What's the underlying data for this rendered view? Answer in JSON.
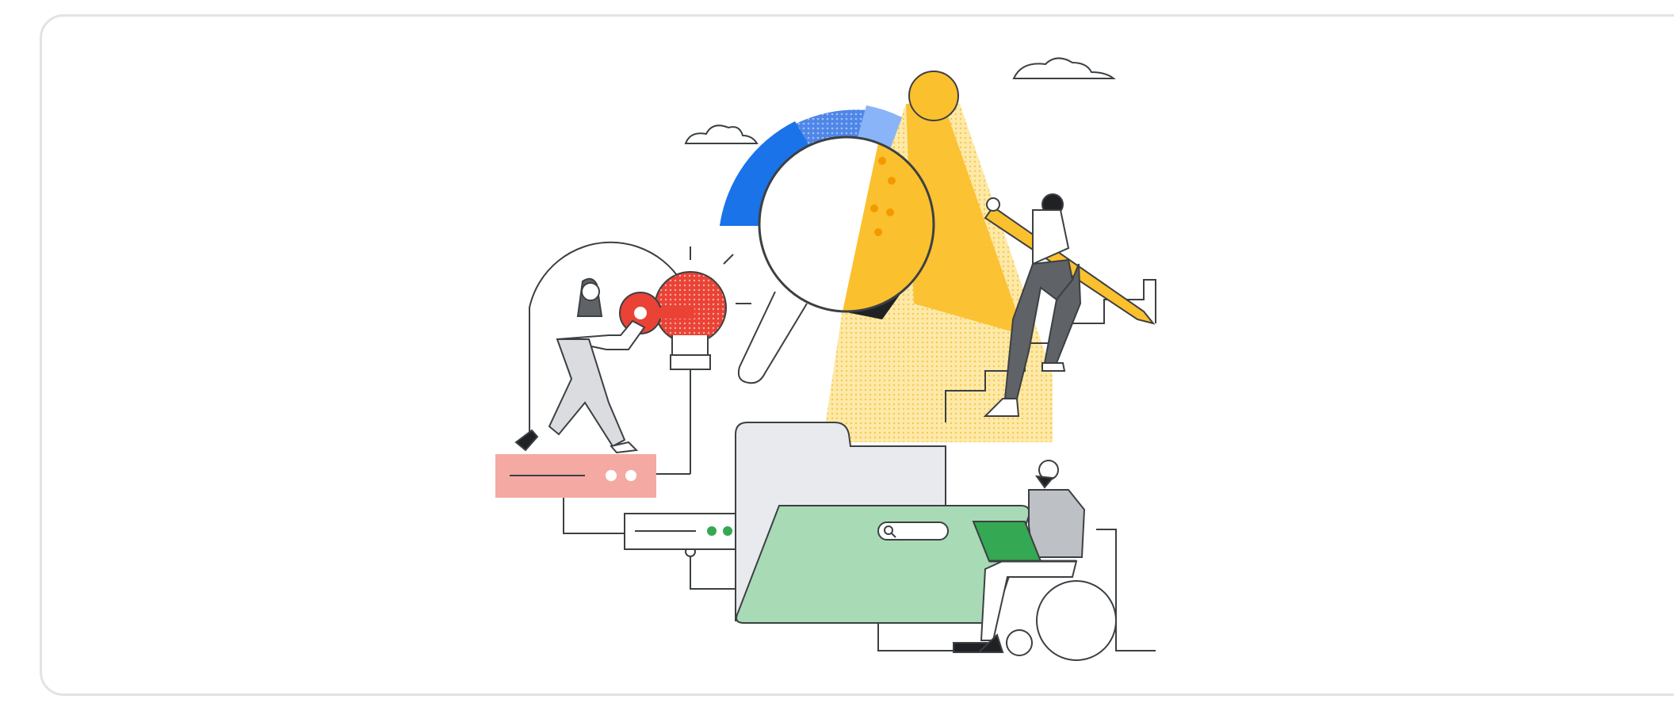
{
  "card": {
    "illustration": {
      "icons": {
        "search_bar": "search-icon",
        "lightbulb": "lightbulb-icon",
        "key": "key-icon",
        "magnifier": "magnifying-glass-icon",
        "pencil": "pencil-icon",
        "laptop": "laptop-icon",
        "wheelchair": "wheelchair-icon",
        "folder": "folder-icon",
        "clouds": "cloud-icon"
      },
      "colors": {
        "blue": "#1a73e8",
        "light_blue": "#8ab4f8",
        "yellow": "#fbc02d",
        "light_yellow": "#fde293",
        "red": "#ea4335",
        "pink": "#f4a9a3",
        "green": "#34a853",
        "light_green": "#a8dab5",
        "gray": "#5f6368",
        "light_gray": "#e8eaed",
        "outline": "#3c4043"
      }
    }
  }
}
